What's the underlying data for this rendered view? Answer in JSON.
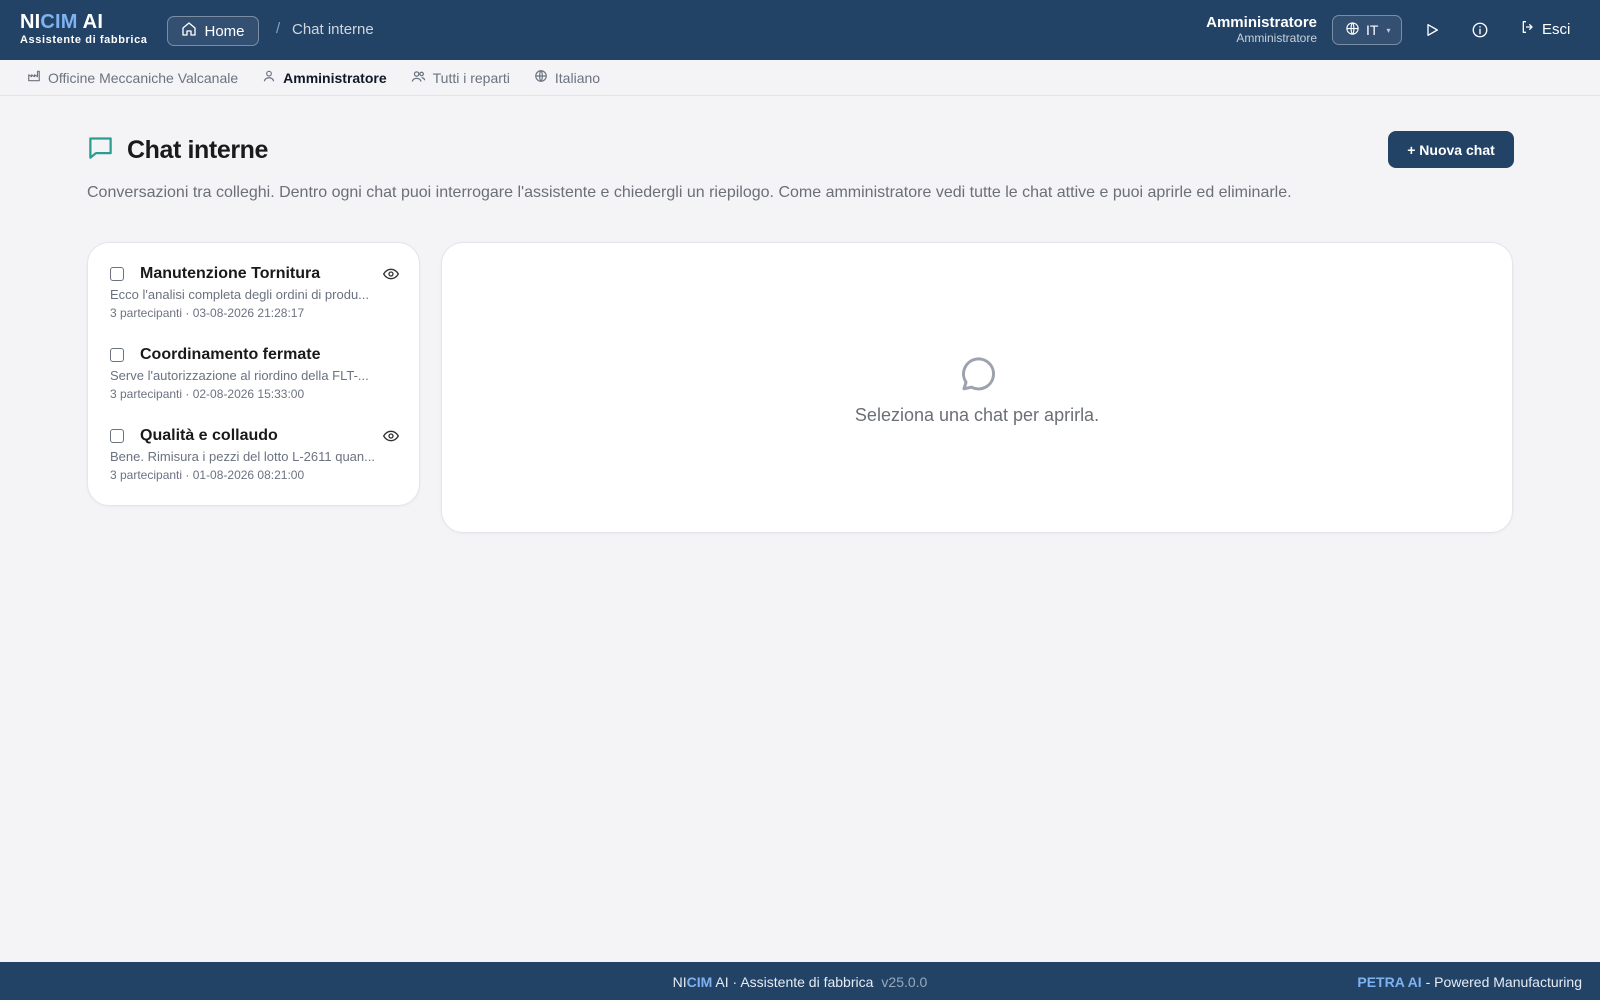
{
  "brand": {
    "name_part1": "NI",
    "name_part2": "CIM",
    "name_part3": " AI",
    "subtitle": "Assistente di fabbrica"
  },
  "breadcrumb": {
    "home": "Home",
    "separator": "/",
    "current": "Chat interne"
  },
  "user": {
    "name": "Amministratore",
    "role": "Amministratore"
  },
  "language_button": {
    "code": "IT"
  },
  "icons": {
    "home": "home-icon",
    "globe": "globe-icon",
    "play": "play-icon",
    "info": "info-icon",
    "logout": "logout-icon",
    "factory": "factory-icon",
    "user": "user-icon",
    "users": "users-icon",
    "chat": "chat-bubble-icon",
    "eye": "eye-icon"
  },
  "logout_label": "Esci",
  "subbar": {
    "company": "Officine Meccaniche Valcanale",
    "user": "Amministratore",
    "departments": "Tutti i reparti",
    "language": "Italiano"
  },
  "page": {
    "title": "Chat interne",
    "new_chat": "+ Nuova chat",
    "description": "Conversazioni tra colleghi. Dentro ogni chat puoi interrogare l'assistente e chiedergli un riepilogo. Come amministratore vedi tutte le chat attive e puoi aprirle ed eliminarle."
  },
  "chats": [
    {
      "title": "Manutenzione Tornitura",
      "preview": "Ecco l'analisi completa degli ordini di produ...",
      "meta": "3 partecipanti · 03-08-2026 21:28:17",
      "viewed": true
    },
    {
      "title": "Coordinamento fermate",
      "preview": "Serve l'autorizzazione al riordino della FLT-...",
      "meta": "3 partecipanti · 02-08-2026 15:33:00",
      "viewed": false
    },
    {
      "title": "Qualità e collaudo",
      "preview": "Bene. Rimisura i pezzi del lotto L-2611 quan...",
      "meta": "3 partecipanti · 01-08-2026 08:21:00",
      "viewed": true
    }
  ],
  "empty_state": "Seleziona una chat per aprirla.",
  "footer": {
    "part1": "NI",
    "part2": "CIM",
    "part3": " AI · Assistente di fabbrica",
    "version": "v25.0.0",
    "right_brand": "PETRA AI",
    "right_text": " - Powered Manufacturing"
  },
  "colors": {
    "primary": "#224266",
    "accent": "#7fb2f0",
    "chat_icon": "#2a9d8f",
    "background": "#f4f4f7"
  }
}
